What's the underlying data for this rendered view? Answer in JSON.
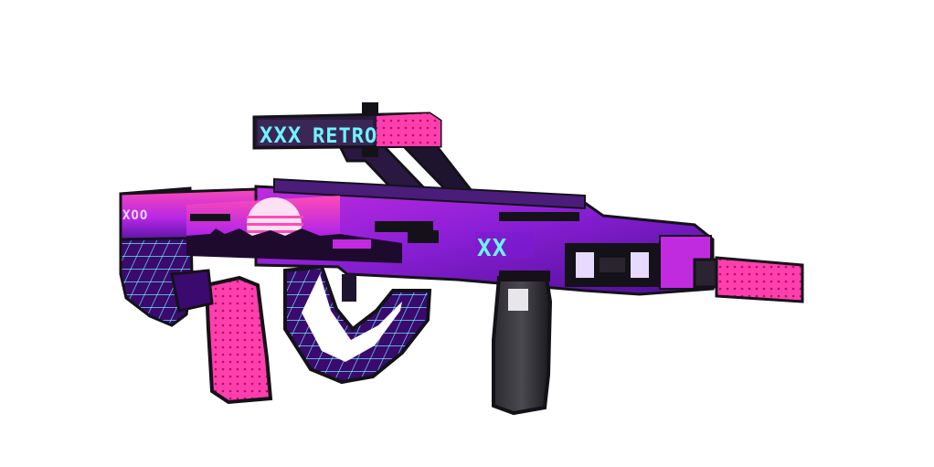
{
  "image": {
    "subject": "voxel-rifle-render",
    "background_color": "#ffffff"
  },
  "scope_text": {
    "left": "XXX",
    "right": "RETRO"
  },
  "stock_text": "XOO",
  "body_text": "XX",
  "colors": {
    "magenta": "#ff2d9b",
    "hot_pink": "#ff3fae",
    "purple": "#7a1bd1",
    "deep_purple": "#3a0a6e",
    "violet": "#a43df0",
    "cyan": "#6ff3ff",
    "sun": "#ffe9f6",
    "black": "#141218",
    "dark": "#2a2430"
  }
}
